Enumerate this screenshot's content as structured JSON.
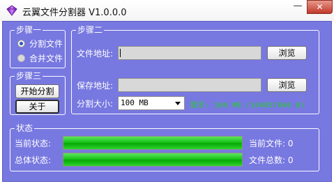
{
  "window": {
    "title": "云翼文件分割器 V1.0.0.0",
    "minimize_glyph": "—",
    "close_glyph": "✕",
    "icon": "purple-diamond-icon"
  },
  "step1": {
    "title": "步骤一",
    "options": [
      {
        "label": "分割文件",
        "selected": true
      },
      {
        "label": "合并文件",
        "selected": false
      }
    ]
  },
  "step2": {
    "title": "步骤二",
    "file_label": "文件地址:",
    "file_value": "",
    "browse_label": "浏览",
    "save_label": "保存地址:",
    "save_value": "",
    "browse2_label": "浏览",
    "size_label": "分割大小:",
    "size_value": "100 MB",
    "hint": "提示: 100 MB (104857600 B)"
  },
  "step3": {
    "title": "步骤三",
    "start_label": "开始分割",
    "about_label": "关于"
  },
  "status": {
    "title": "状态",
    "current_label": "当前状态:",
    "current_progress": 1.0,
    "total_label": "总体状态:",
    "total_progress": 1.0,
    "current_file": "当前文件: 0",
    "file_count": "文件总数: 0"
  },
  "colors": {
    "panel": "#7778e0",
    "progress": "#19c419",
    "hint": "#1fd31f"
  }
}
